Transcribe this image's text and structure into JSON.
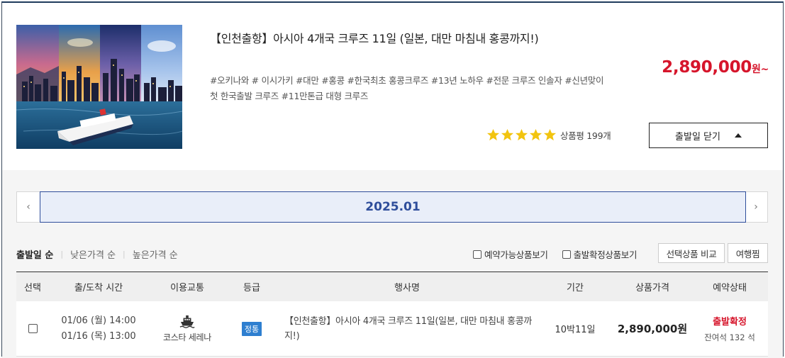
{
  "product": {
    "title": "【인천출항】아시아 4개국 크루즈 11일 (일본, 대만 마침내 홍콩까지!)",
    "price": "2,890,000",
    "price_unit": "원~",
    "tags": "#오키나와 # 이시가키 #대만 #홍콩 #한국최초 홍콩크루즈 #13년 노하우 #전문 크루즈 인솔자 #신년맞이 첫 한국출발 크루즈 #11만톤급 대형 크루즈",
    "rating": {
      "stars": 5,
      "label": "상품평 199개",
      "star_color": "#f2c40f"
    },
    "toggle_label": "출발일 닫기"
  },
  "calendar": {
    "month": "2025.01",
    "prev_icon": "chevron-left-icon",
    "next_icon": "chevron-right-icon",
    "accent_color": "#2f4e9b"
  },
  "sort": {
    "options": [
      "출발일 순",
      "낮은가격 순",
      "높은가격 순"
    ],
    "active": "출발일 순"
  },
  "filters": {
    "available_label": "예약가능상품보기",
    "confirmed_label": "출발확정상품보기",
    "compare_label": "선택상품 비교",
    "wishlist_label": "여행찜"
  },
  "table": {
    "headers": [
      "선택",
      "출/도착 시간",
      "이용교통",
      "등급",
      "행사명",
      "기간",
      "상품가격",
      "예약상태"
    ],
    "rows": [
      {
        "depart": "01/06 (월) 14:00",
        "arrive": "01/16 (목) 13:00",
        "transport": "코스타 세레나",
        "transport_icon": "ship-icon",
        "grade": "정통",
        "name": "【인천출항】아시아 4개국 크루즈 11일(일본, 대만 마침내 홍콩까지!)",
        "duration": "10박11일",
        "price": "2,890,000원",
        "status": "출발확정",
        "seats": "잔여석 132 석"
      }
    ]
  }
}
